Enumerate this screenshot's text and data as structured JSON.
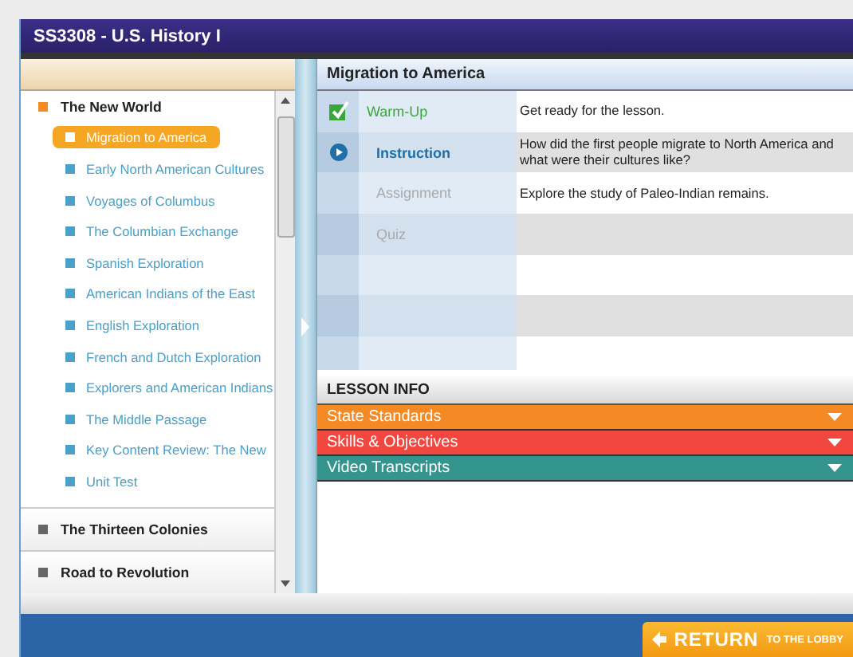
{
  "window": {
    "title": "SS3308 - U.S. History I"
  },
  "sidebar": {
    "units": [
      {
        "title": "The New World",
        "expanded": true,
        "children": [
          {
            "label": "Migration to America",
            "selected": true
          },
          {
            "label": "Early North American Cultures",
            "selected": false
          },
          {
            "label": "Voyages of Columbus",
            "selected": false
          },
          {
            "label": "The Columbian Exchange",
            "selected": false
          },
          {
            "label": "Spanish Exploration",
            "selected": false
          },
          {
            "label": "American Indians of the East",
            "selected": false
          },
          {
            "label": "English Exploration",
            "selected": false
          },
          {
            "label": "French and Dutch Exploration",
            "selected": false
          },
          {
            "label": "Explorers and American Indians",
            "selected": false
          },
          {
            "label": "The Middle Passage",
            "selected": false
          },
          {
            "label": "Key Content Review: The New",
            "selected": false
          },
          {
            "label": "Unit Test",
            "selected": false
          }
        ]
      },
      {
        "title": "The Thirteen Colonies",
        "expanded": false
      },
      {
        "title": "Road to Revolution",
        "expanded": false
      }
    ]
  },
  "lesson": {
    "title": "Migration to America",
    "activities": [
      {
        "name": "Warm-Up",
        "completed": true,
        "selected": false,
        "disabled": false,
        "description": "Get ready for the lesson."
      },
      {
        "name": "Instruction",
        "completed": false,
        "selected": true,
        "disabled": false,
        "description": "How did the first people migrate to North America and what were their cultures like?"
      },
      {
        "name": "Assignment",
        "completed": false,
        "selected": false,
        "disabled": true,
        "description": "Explore the study of Paleo-Indian remains."
      },
      {
        "name": "Quiz",
        "completed": false,
        "selected": false,
        "disabled": true
      }
    ]
  },
  "lesson_info": {
    "title": "LESSON INFO",
    "sections": [
      {
        "label": "State Standards",
        "color": "#f58a25"
      },
      {
        "label": "Skills & Objectives",
        "color": "#f2473f"
      },
      {
        "label": "Video Transcripts",
        "color": "#33958d"
      }
    ]
  },
  "footer": {
    "return_button": {
      "label": "RETURN",
      "sublabel": "TO THE LOBBY"
    }
  }
}
